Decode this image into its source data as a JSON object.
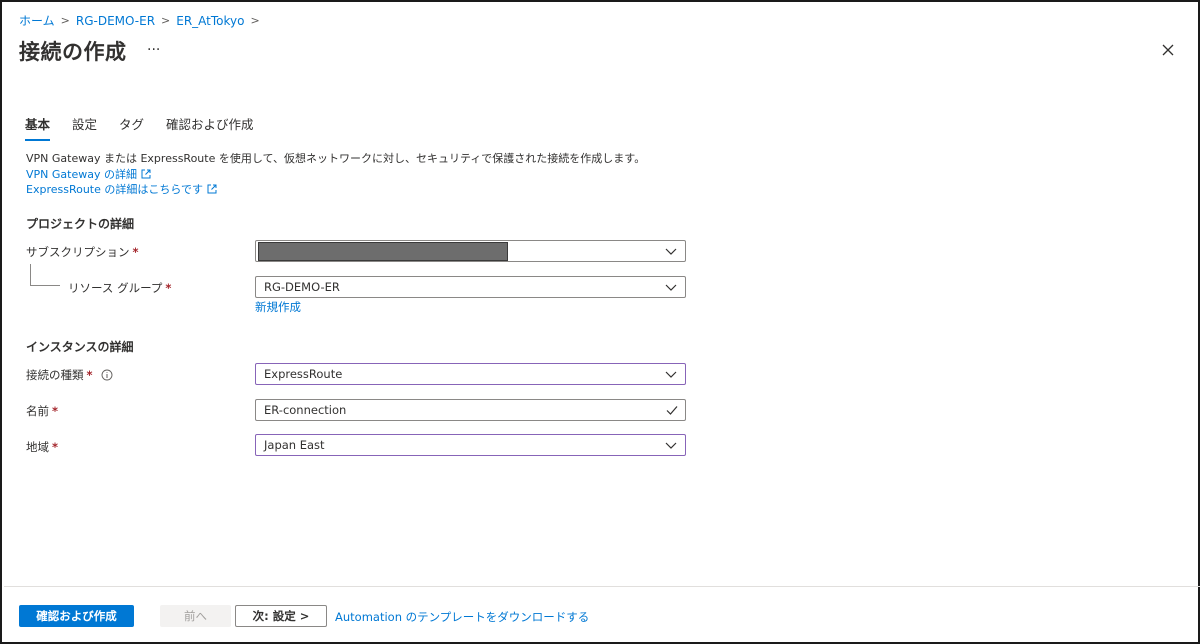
{
  "breadcrumb": [
    "ホーム",
    "RG-DEMO-ER",
    "ER_AtTokyo"
  ],
  "page_title": "接続の作成",
  "more_label": "···",
  "tabs": [
    {
      "label": "基本",
      "active": true
    },
    {
      "label": "設定",
      "active": false
    },
    {
      "label": "タグ",
      "active": false
    },
    {
      "label": "確認および作成",
      "active": false
    }
  ],
  "description": "VPN Gateway または ExpressRoute を使用して、仮想ネットワークに対し、セキュリティで保護された接続を作成します。",
  "links": {
    "vpn_details": "VPN Gateway の詳細",
    "er_details": "ExpressRoute の詳細はこちらです"
  },
  "project": {
    "title": "プロジェクトの詳細",
    "subscription_label": "サブスクリプション",
    "subscription_value": "",
    "rg_label": "リソース グループ",
    "rg_value": "RG-DEMO-ER",
    "new_link": "新規作成"
  },
  "instance": {
    "title": "インスタンスの詳細",
    "type_label": "接続の種類",
    "type_value": "ExpressRoute",
    "name_label": "名前",
    "name_value": "ER-connection",
    "region_label": "地域",
    "region_value": "Japan East"
  },
  "required_mark": "*",
  "footer": {
    "review_create": "確認および作成",
    "previous": "前へ",
    "next": "次: 設定 >",
    "automation_link": "Automation のテンプレートをダウンロードする"
  },
  "colors": {
    "accent": "#0078d4",
    "required": "#a4262c",
    "focus_border": "#8764b8"
  }
}
